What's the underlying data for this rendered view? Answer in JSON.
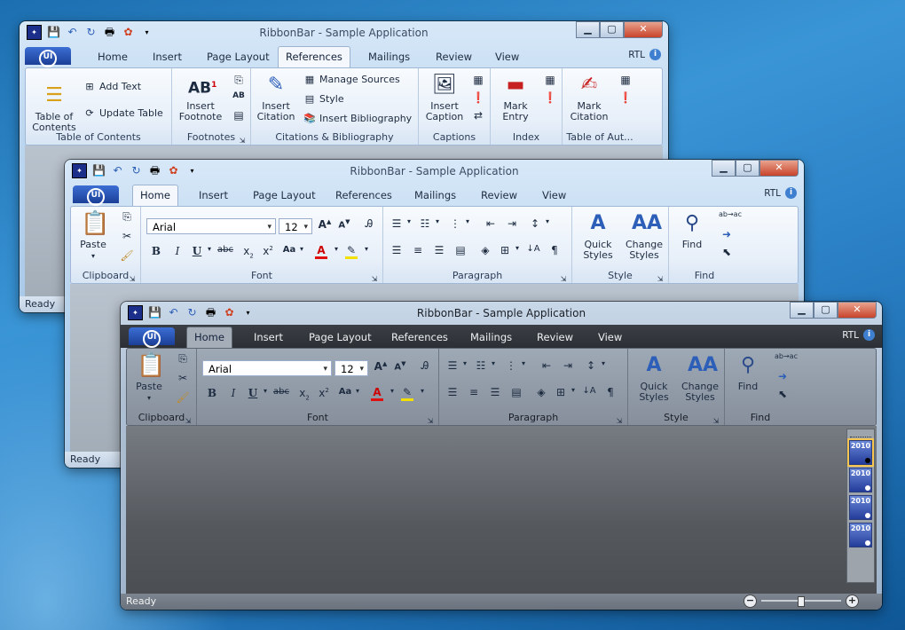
{
  "app_title": "RibbonBar - Sample Application",
  "rtl_label": "RTL",
  "help_label": "i",
  "app_button": "UI",
  "status_text": "Ready",
  "tabs": [
    "Home",
    "Insert",
    "Page Layout",
    "References",
    "Mailings",
    "Review",
    "View"
  ],
  "window_back": {
    "active_tab": "References",
    "groups": {
      "toc": {
        "label": "Table of Contents",
        "big": "Table of\nContents",
        "add_text": "Add Text",
        "update_table": "Update Table"
      },
      "footnotes": {
        "label": "Footnotes",
        "big": "Insert\nFootnote"
      },
      "citations": {
        "label": "Citations & Bibliography",
        "big": "Insert\nCitation",
        "manage": "Manage Sources",
        "style": "Style",
        "bibliography": "Insert Bibliography"
      },
      "captions": {
        "label": "Captions",
        "big": "Insert\nCaption"
      },
      "index": {
        "label": "Index",
        "big": "Mark\nEntry"
      },
      "toa": {
        "label": "Table of Aut...",
        "big": "Mark\nCitation"
      }
    }
  },
  "home_ribbon": {
    "active_tab": "Home",
    "clipboard": {
      "label": "Clipboard",
      "paste": "Paste"
    },
    "font": {
      "label": "Font",
      "font_name": "Arial",
      "font_size": "12"
    },
    "paragraph": {
      "label": "Paragraph"
    },
    "style": {
      "label": "Style",
      "quick_styles": "Quick\nStyles",
      "change_styles": "Change\nStyles"
    },
    "find": {
      "label": "Find",
      "find": "Find"
    }
  },
  "gallery": {
    "items": [
      "2010",
      "2010",
      "2010",
      "2010"
    ]
  }
}
